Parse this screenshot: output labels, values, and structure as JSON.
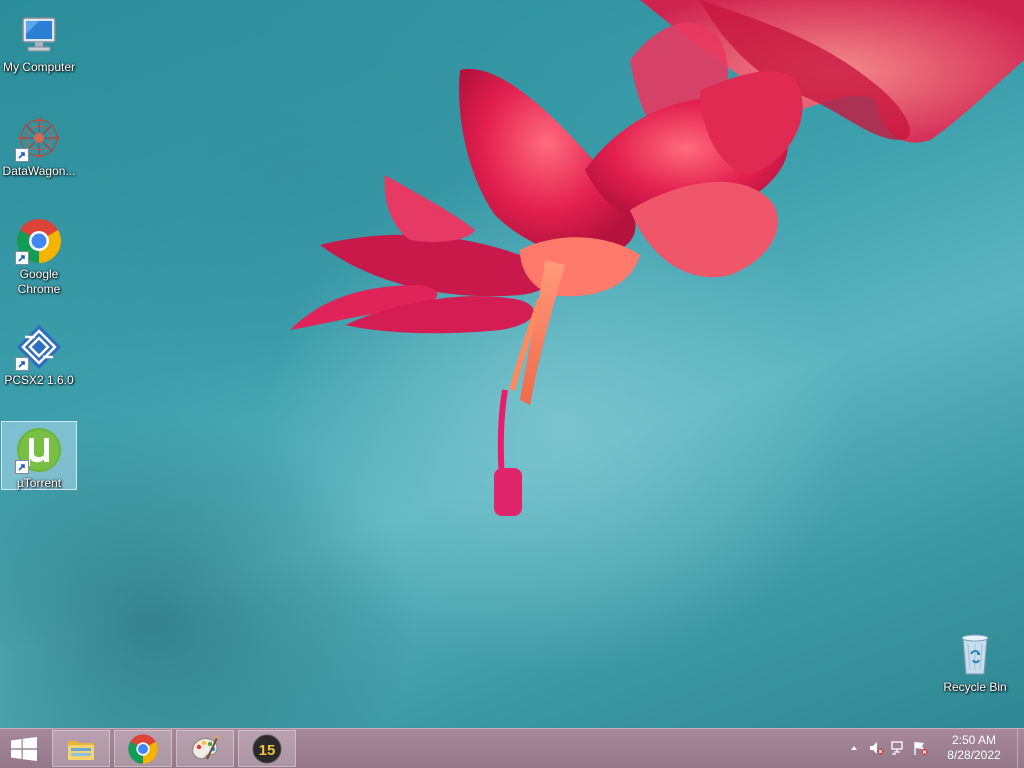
{
  "desktop": {
    "icons": [
      {
        "label": "My Computer",
        "icon": "computer-icon",
        "shortcut": false,
        "selected": false
      },
      {
        "label": "DataWagon...",
        "icon": "datawagon-icon",
        "shortcut": true,
        "selected": false
      },
      {
        "label": "Google Chrome",
        "icon": "chrome-icon",
        "shortcut": true,
        "selected": false
      },
      {
        "label": "PCSX2 1.6.0",
        "icon": "pcsx2-icon",
        "shortcut": true,
        "selected": false
      },
      {
        "label": "µTorrent",
        "icon": "utorrent-icon",
        "shortcut": true,
        "selected": true
      },
      {
        "label": "Recycle Bin",
        "icon": "recycle-bin-icon",
        "shortcut": false,
        "selected": false
      }
    ]
  },
  "taskbar": {
    "start_icon": "windows-logo-icon",
    "pinned": [
      {
        "icon": "file-explorer-icon"
      },
      {
        "icon": "chrome-icon"
      },
      {
        "icon": "paint-icon"
      },
      {
        "icon": "app-15-icon",
        "badge_text": "15"
      }
    ],
    "tray": {
      "icons": [
        "show-hidden-icons-chevron",
        "volume-muted-icon",
        "network-disconnected-icon",
        "action-center-flag-icon"
      ],
      "time": "2:50 AM",
      "date": "8/28/2022"
    }
  },
  "colors": {
    "desktop_teal": "#3c9fab",
    "taskbar": "#9f8494",
    "flower_red": "#e0245a"
  }
}
